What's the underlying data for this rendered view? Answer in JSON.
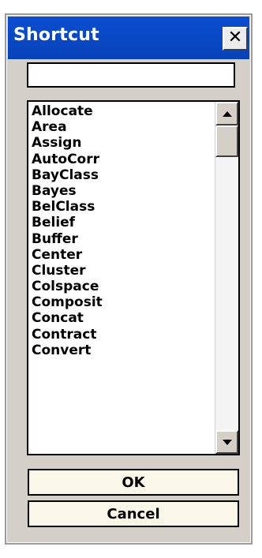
{
  "window": {
    "title": "Shortcut",
    "close_symbol": "✕"
  },
  "search": {
    "value": "",
    "placeholder": ""
  },
  "list": {
    "items": [
      "Allocate",
      "Area",
      "Assign",
      "AutoCorr",
      "BayClass",
      "Bayes",
      "BelClass",
      "Belief",
      "Buffer",
      "Center",
      "Cluster",
      "Colspace",
      "Composit",
      "Concat",
      "Contract",
      "Convert"
    ]
  },
  "buttons": {
    "ok_label": "OK",
    "cancel_label": "Cancel"
  },
  "colors": {
    "titlebar": "#0a4ed2",
    "window_face": "#d4d0c8",
    "button_face": "#faf7e8"
  },
  "icons": {
    "close": "close-icon",
    "scroll_up": "arrow-up-icon",
    "scroll_down": "arrow-down-icon"
  }
}
